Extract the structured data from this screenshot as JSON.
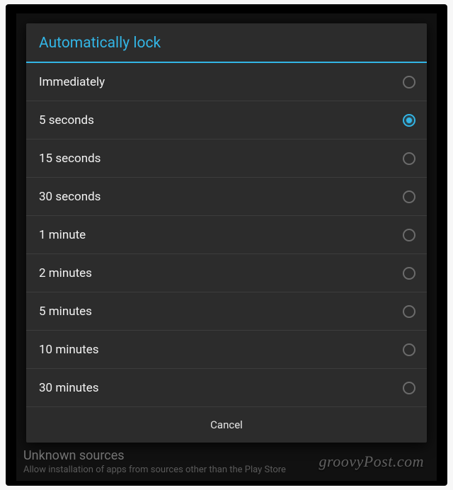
{
  "dialog": {
    "title": "Automatically lock",
    "options": [
      {
        "label": "Immediately",
        "selected": false
      },
      {
        "label": "5 seconds",
        "selected": true
      },
      {
        "label": "15 seconds",
        "selected": false
      },
      {
        "label": "30 seconds",
        "selected": false
      },
      {
        "label": "1 minute",
        "selected": false
      },
      {
        "label": "2 minutes",
        "selected": false
      },
      {
        "label": "5 minutes",
        "selected": false
      },
      {
        "label": "10 minutes",
        "selected": false
      },
      {
        "label": "30 minutes",
        "selected": false
      }
    ],
    "cancel_label": "Cancel"
  },
  "background": {
    "setting_title": "Unknown sources",
    "setting_subtitle": "Allow installation of apps from sources other than the Play Store"
  },
  "watermark": "groovyPost.com"
}
